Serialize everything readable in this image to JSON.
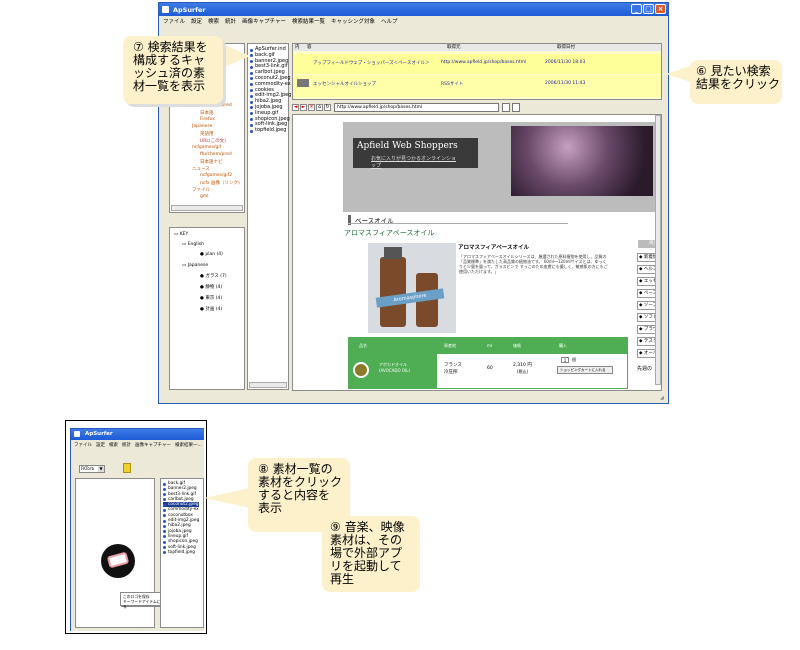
{
  "app": {
    "title": "ApSurfer"
  },
  "menu": [
    "ファイル",
    "設定",
    "検索",
    "統計",
    "画像キャプチャー",
    "検索結果一覧",
    "キャッシング対象",
    "ヘルプ"
  ],
  "small_menu": [
    "ファイル",
    "設定",
    "検索",
    "統計",
    "画像キャプチャー",
    "検索結果一..."
  ],
  "results": {
    "headers": [
      "内",
      "容",
      "取得元",
      "取得日付"
    ],
    "rows": [
      {
        "title": "アップフィールドウェブ・ショッパーズ＜ベースオイル＞",
        "url": "http://www.apfield.jp/shop/bases.html",
        "date": "2006/11/30 18:03"
      },
      {
        "title": "エッセンシャルオイルショップ",
        "url": "RSSサイト",
        "date": "2006/11/30 11:43"
      }
    ]
  },
  "tree": {
    "items": [
      "ncfgames/emb",
      "ffu/chem/pred",
      "日本語",
      "Firefox",
      "Japanese",
      "英語用",
      "URL(この文)",
      "ncfgames/gif",
      "ffu/chem/pred",
      "日本語ナビ",
      "ニュース",
      "ncfgames/gif2",
      "ncfx 画像（リンク)",
      "ファイル",
      "gml"
    ]
  },
  "keytree": {
    "root": "KEY",
    "groups": [
      {
        "name": "English",
        "items": [
          "plan (4)"
        ]
      },
      {
        "name": "Japanese",
        "items": [
          "ガラス (7)",
          "静物 (4)",
          "東京 (4)",
          "計画 (4)"
        ]
      }
    ]
  },
  "files": [
    "ApSurfer.ind",
    "back.gif",
    "banner2.jpeg",
    "best3-link.gif",
    "carlbot.jpeg",
    "coconut2.jpeg",
    "commodity-ex",
    "cookies",
    "edit-img2.jpeg",
    "hiba2.jpeg",
    "jojoba.jpeg",
    "lineup.gif",
    "shopicon.jpeg",
    "soft-link.jpeg",
    "topfield.jpeg"
  ],
  "files_small": [
    "back.gif",
    "banner2.jpeg",
    "best3-link.gif",
    "carlbot.jpeg",
    "coconut2.jpeg",
    "commodity-ex",
    "coconutbox",
    "edit-img2.jpeg",
    "hiba2.jpeg",
    "jojoba.jpeg",
    "lineup.gif",
    "shopicon.jpeg",
    "soft-link.jpeg",
    "topfield.jpeg"
  ],
  "browser": {
    "address": "http://www.apfield.jp/shop/bases.html",
    "site_title": "Apfield Web Shoppers",
    "site_subtitle": "お気に入りが見つかるオンラインショップ",
    "section": "ベースオイル",
    "subsection": "アロマスフィアベースオイル",
    "product_title": "アロマスフィアベースオイル",
    "product_desc": "「アロマスフィアベースオイルシリーズは、厳選された原料植物を使用し、品質の「品質標準」を満たした高品質の植物油です。 60ml～120mlサイズとは、ゆっくりと少量を量って、ガラスビンで すっこのため皮膚にも優しく、敏感肌の方にもご使用いただけます。」",
    "bottle_label": "Aromasphere",
    "table_headers": [
      "品名",
      "原産地",
      "ml",
      "価格",
      "購入"
    ],
    "table_row": {
      "name": "アボカドオイル",
      "code": "(AVOCADO OIL)",
      "origin": "フランス",
      "origin2": "冷圧搾",
      "ml": "60",
      "price": "2,310 円",
      "tax": "(税込)",
      "qty": "1",
      "unit": "個",
      "cart": "ショッピングカートに入れる"
    },
    "side_tab": "商品",
    "side_items": [
      "新着情報",
      "ヘルスケア",
      "エッセンシャル",
      "ベースオイル",
      "ソープ",
      "ソフト",
      "ブラウザ",
      "テスクワーク",
      "オーバーレイ"
    ],
    "side_footer": "先週の"
  },
  "small_window": {
    "dropdown": "FKTorb",
    "popup": [
      "このロゴを保存",
      "キーワードアイテムにする"
    ]
  },
  "callouts": {
    "c7": "⑦ 検索結果を\n構成するキャ\nッシュ済の素\n材一覧を表示",
    "c6": "⑥ 見たい検索\n結果をクリック",
    "c8": "⑧ 素材一覧の\n素材をクリック\nすると内容を\n表示",
    "c9": "⑨ 音楽、映像\n素材は、その\n場で外部アプ\nリを起動して\n再生"
  },
  "colors": {
    "accent": "#1d5bd6",
    "highlight": "#ffff99",
    "callout": "#fdf1cc",
    "table_green": "#4fae54",
    "header_dark": "#3a3a3a"
  }
}
